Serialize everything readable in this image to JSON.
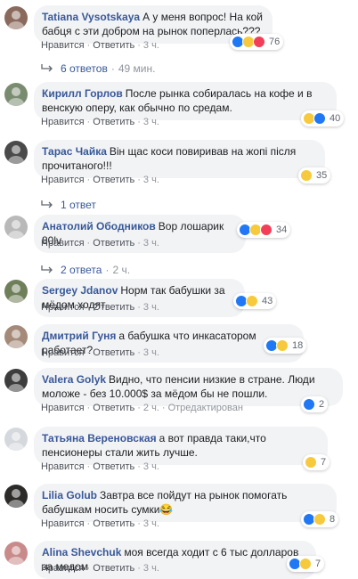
{
  "ui": {
    "like_label": "Нравится",
    "reply_label": "Ответить",
    "dot": "·"
  },
  "comments": [
    {
      "author": "Tatiana Vysotskaya",
      "text": "А у меня вопрос! На кой бабця с эти добром на рынок поперлась???",
      "time": "3 ч.",
      "reaction_icons": [
        "like-icon",
        "haha-icon",
        "angry-icon"
      ],
      "reaction_count": "76",
      "replies_label": "6 ответов",
      "replies_time": "49 мин."
    },
    {
      "author": "Кирилл Горлов",
      "text": "После рынка собиралась на кофе и в венскую оперу, как обычно по средам.",
      "time": "3 ч.",
      "reaction_icons": [
        "haha-icon",
        "like-icon"
      ],
      "reaction_count": "40"
    },
    {
      "author": "Тарас Чайка",
      "text": "Він щас коси повиривав на жопі після прочитаного!!!",
      "time": "3 ч.",
      "reaction_icons": [
        "haha-icon"
      ],
      "reaction_count": "35",
      "replies_label": "1 ответ"
    },
    {
      "author": "Анатолий Ободников",
      "text": "Вор лошарик 80lv",
      "time": "3 ч.",
      "reaction_icons": [
        "like-icon",
        "haha-icon",
        "angry-icon"
      ],
      "reaction_count": "34",
      "replies_label": "2 ответа",
      "replies_time": "2 ч."
    },
    {
      "author": "Sergey Jdanov",
      "text": "Норм так бабушки за мёдом ходят",
      "time": "3 ч.",
      "reaction_icons": [
        "like-icon",
        "haha-icon"
      ],
      "reaction_count": "43"
    },
    {
      "author": "Дмитрий Гуня",
      "text": "а бабушка что инкасатором работает?",
      "time": "3 ч.",
      "reaction_icons": [
        "like-icon",
        "haha-icon"
      ],
      "reaction_count": "18"
    },
    {
      "author": "Valera Golyk",
      "text": "Видно, что пенсии низкие в стране. Люди моложе - без 10.000$ за мёдом бы не пошли.",
      "time": "2 ч.",
      "edited": "Отредактирован",
      "reaction_icons": [
        "like-icon"
      ],
      "reaction_count": "2"
    },
    {
      "author": "Татьяна Вереновская",
      "text": "а вот правда таки,что пенсионеры стали жить лучше.",
      "time": "3 ч.",
      "reaction_icons": [
        "haha-icon"
      ],
      "reaction_count": "7"
    },
    {
      "author": "Lilia Golub",
      "text": "Завтра все пойдут на рынок помогать бабушкам носить сумки😂",
      "time": "3 ч.",
      "reaction_icons": [
        "like-icon",
        "haha-icon"
      ],
      "reaction_count": "8"
    },
    {
      "author": "Alina Shevchuk",
      "text": "моя всегда ходит с 6 тыс долларов за медом",
      "time": "3 ч.",
      "reaction_icons": [
        "like-icon",
        "haha-icon"
      ],
      "reaction_count": "7"
    }
  ]
}
